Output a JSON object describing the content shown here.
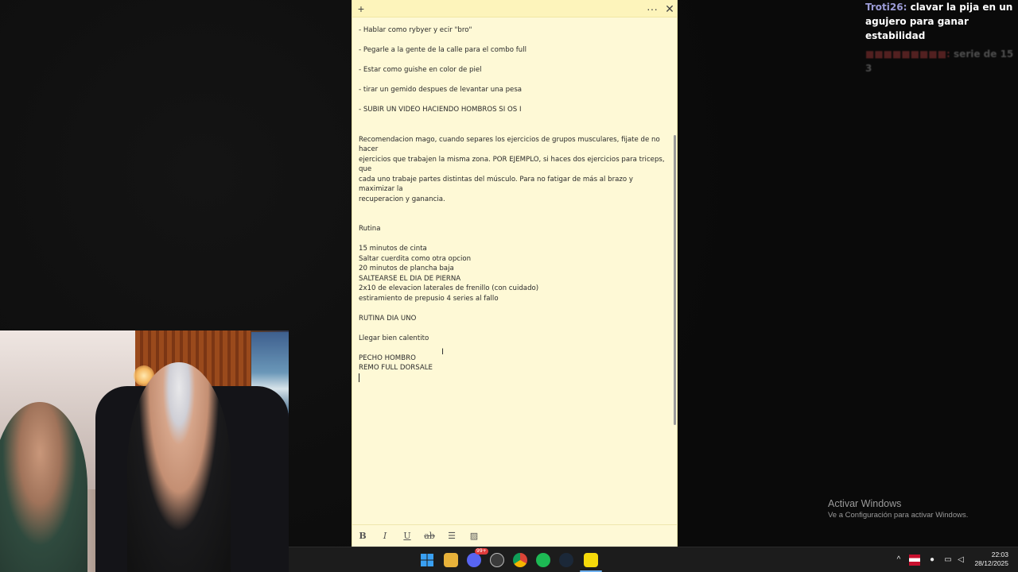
{
  "note": {
    "lines": [
      "- Hablar como rybyer y ecir \"bro\"",
      "",
      "- Pegarle a la gente de la calle para el combo full",
      "",
      "- Estar como guishe en color de piel",
      "",
      "- tirar un gemido despues de levantar una pesa",
      "",
      "- SUBIR UN VIDEO HACIENDO HOMBROS SI OS I",
      "",
      "",
      "Recomendacion mago, cuando separes los ejercicios de grupos musculares, fijate de no hacer",
      "ejercicios que trabajen la misma zona. POR EJEMPLO, si haces dos ejercicios para triceps, que",
      "cada uno trabaje partes distintas del músculo. Para no fatigar de más al brazo y maximizar la",
      "recuperacion y ganancia.",
      "",
      "",
      "Rutina",
      "",
      "15 minutos de cinta",
      "Saltar cuerdita como otra opcion",
      "20 minutos de plancha baja",
      "SALTEARSE EL DIA DE PIERNA",
      "2x10 de elevacion laterales de frenillo (con cuidado)",
      "estiramiento de prepusio 4 series al fallo",
      "",
      "RUTINA DIA UNO",
      "",
      "Llegar bien calentito",
      "",
      "PECHO HOMBRO",
      "REMO FULL DORSALE"
    ],
    "titlebar": {
      "add_icon": "+",
      "more_icon": "···",
      "close_icon": "✕"
    },
    "toolbar": {
      "bold": "B",
      "italic": "I",
      "underline": "U",
      "strike": "ab",
      "list": "☰",
      "image": "▨"
    }
  },
  "chat": {
    "message1_user": "Troti26:",
    "message1_text": "clavar la pija en un agujero para ganar estabilidad",
    "message2_text": "serie de 15 3"
  },
  "watermark": {
    "title": "Activar Windows",
    "subtitle": "Ve a Configuración para activar Windows."
  },
  "taskbar": {
    "time": "22:03",
    "date": "28/12/2025",
    "discord_badge": "99+"
  }
}
